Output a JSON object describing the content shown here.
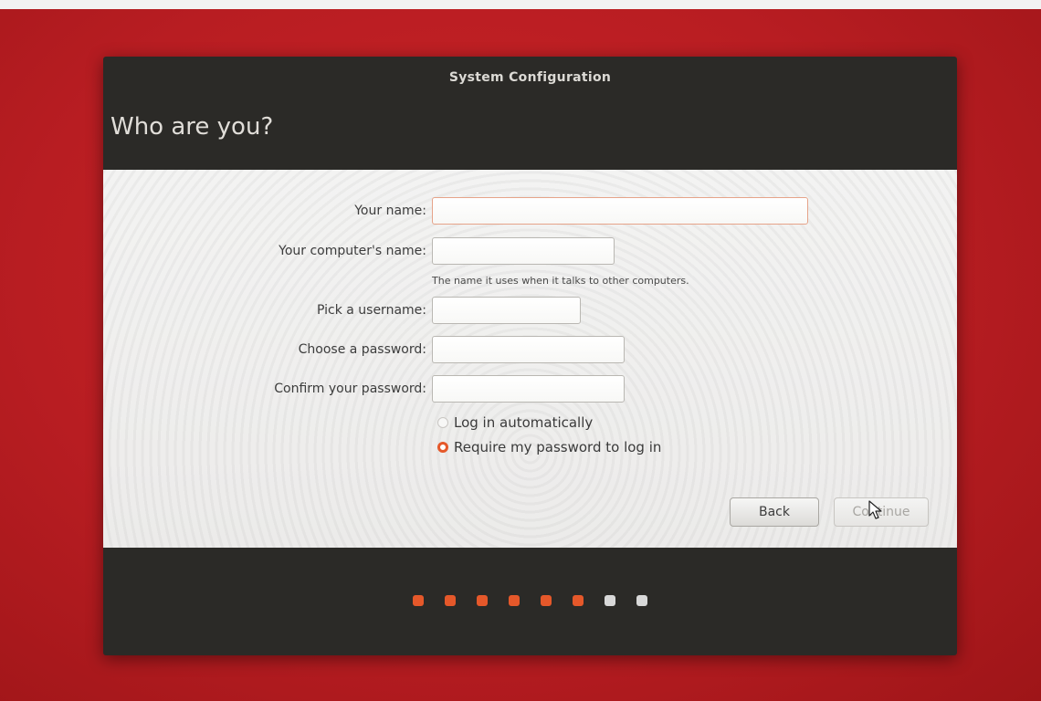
{
  "window": {
    "title": "System Configuration"
  },
  "page": {
    "title": "Who are you?"
  },
  "form": {
    "name_label": "Your name:",
    "name_value": "",
    "computer_label": "Your computer's name:",
    "computer_value": "",
    "computer_hint": "The name it uses when it talks to other computers.",
    "username_label": "Pick a username:",
    "username_value": "",
    "password_label": "Choose a password:",
    "password_value": "",
    "confirm_label": "Confirm your password:",
    "confirm_value": "",
    "login_options": [
      {
        "label": "Log in automatically",
        "selected": false
      },
      {
        "label": "Require my password to log in",
        "selected": true
      }
    ]
  },
  "buttons": {
    "back_label": "Back",
    "continue_label": "Continue",
    "continue_enabled": false
  },
  "progress": {
    "total_steps": 8,
    "completed_steps": 6,
    "active_color": "#e5582a",
    "inactive_color": "#d8d8d8"
  },
  "colors": {
    "background": "#c01f24",
    "window": "#2b2a27",
    "accent": "#e5582a"
  }
}
